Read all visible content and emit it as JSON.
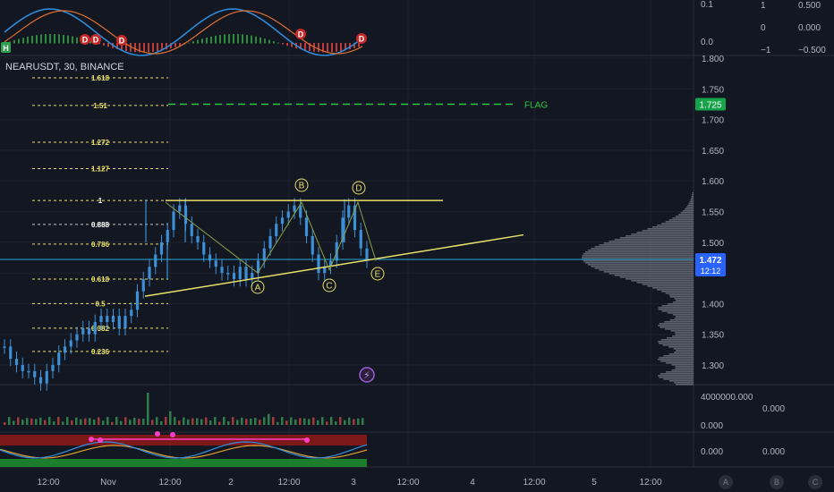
{
  "symbol": "NEARUSDT, 30, BINANCE",
  "colors": {
    "background": "#131722",
    "grid": "#1e222d",
    "fib": "#e8e06a",
    "pattern": "#e8e06a",
    "flag": "#26c840",
    "price_line": "#2fa8d8",
    "candle": "#3d8fd6",
    "axis_text": "#b2b5be"
  },
  "chart_data": {
    "type": "candlestick",
    "price_axis": {
      "ticks": [
        1.8,
        1.75,
        1.7,
        1.65,
        1.6,
        1.55,
        1.5,
        1.45,
        1.4,
        1.35,
        1.3
      ],
      "labels": [
        "1.800",
        "1.750",
        "1.700",
        "1.650",
        "1.600",
        "1.550",
        "1.500",
        "1.450",
        "1.400",
        "1.350",
        "1.300"
      ]
    },
    "time_axis": [
      "12:00",
      "Nov",
      "12:00",
      "2",
      "12:00",
      "3",
      "12:00",
      "4",
      "12:00",
      "5",
      "12:00"
    ],
    "current_price": "1.472",
    "countdown": "12:12",
    "flag_price": "1.725",
    "flag_label": "FLAG",
    "fib_levels": [
      {
        "label": "1.618",
        "price": 1.768
      },
      {
        "label": "1.51",
        "price": 1.723
      },
      {
        "label": "1.272",
        "price": 1.663
      },
      {
        "label": "1.127",
        "price": 1.62
      },
      {
        "label": "1",
        "price": 1.568
      },
      {
        "label": "0.888",
        "price": 1.529
      },
      {
        "label": "0.786",
        "price": 1.497
      },
      {
        "label": "0.618",
        "price": 1.44
      },
      {
        "label": "0.5",
        "price": 1.4
      },
      {
        "label": "0.382",
        "price": 1.36
      },
      {
        "label": "0.236",
        "price": 1.322
      }
    ],
    "pattern_points": [
      "A",
      "B",
      "C",
      "D",
      "E"
    ],
    "close_prices": [
      1.33,
      1.31,
      1.3,
      1.29,
      1.29,
      1.28,
      1.27,
      1.29,
      1.3,
      1.32,
      1.33,
      1.34,
      1.35,
      1.36,
      1.35,
      1.37,
      1.38,
      1.37,
      1.38,
      1.36,
      1.38,
      1.39,
      1.42,
      1.44,
      1.46,
      1.48,
      1.5,
      1.52,
      1.55,
      1.56,
      1.53,
      1.51,
      1.5,
      1.48,
      1.47,
      1.46,
      1.45,
      1.45,
      1.44,
      1.46,
      1.44,
      1.45,
      1.47,
      1.49,
      1.51,
      1.53,
      1.54,
      1.55,
      1.56,
      1.54,
      1.51,
      1.48,
      1.45,
      1.46,
      1.47,
      1.5,
      1.54,
      1.56,
      1.52,
      1.49,
      1.47
    ],
    "top_oscillator": {
      "ticks": [
        "0.1",
        "0.0"
      ],
      "right_ticks": [
        "1",
        "0",
        "−1"
      ],
      "right_values": [
        "0.500",
        "0.000",
        "−0.500"
      ]
    },
    "volume_pane": {
      "labels": [
        "4000000.000",
        "0.000"
      ],
      "value": "0.000"
    },
    "bottom_oscillator": {
      "labels": [
        "0.000"
      ],
      "value": "0.000"
    },
    "bottom_buttons": [
      "A",
      "B",
      "C"
    ]
  }
}
